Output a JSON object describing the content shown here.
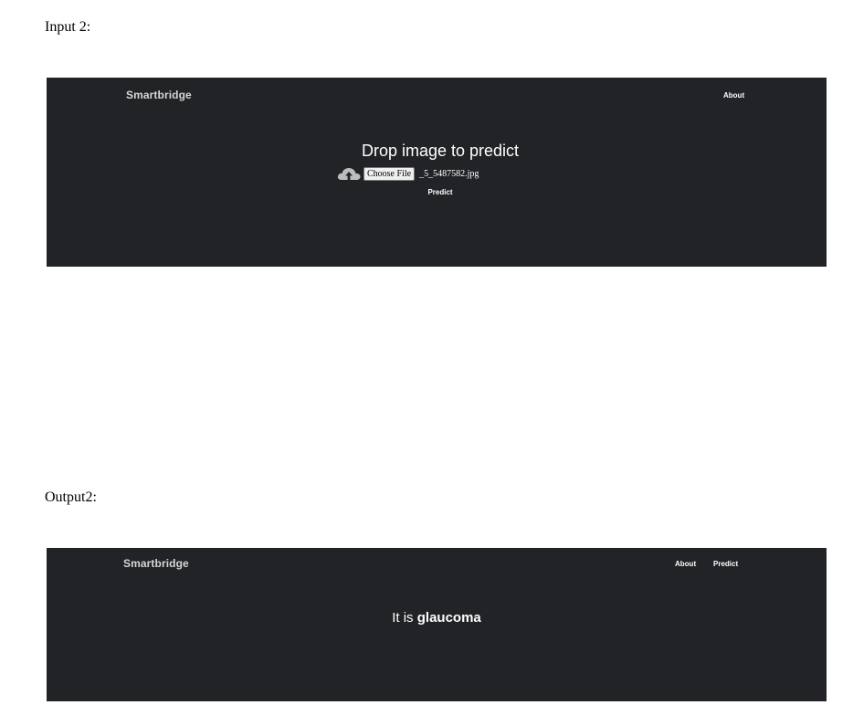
{
  "captions": {
    "input": "Input 2:",
    "output": "Output2:"
  },
  "input_panel": {
    "brand": "Smartbridge",
    "nav": {
      "about": "About"
    },
    "title": "Drop image to predict",
    "upload_icon": "cloud-upload-icon",
    "choose_file_label": "Choose File",
    "file_name": "_5_5487582.jpg",
    "predict_label": "Predict"
  },
  "output_panel": {
    "brand": "Smartbridge",
    "nav": {
      "about": "About",
      "predict": "Predict"
    },
    "result_prefix": "It is",
    "result_value": "glaucoma"
  },
  "colors": {
    "panel_bg": "#222327",
    "text": "#ffffff",
    "brand_text": "#d6d6d6"
  }
}
